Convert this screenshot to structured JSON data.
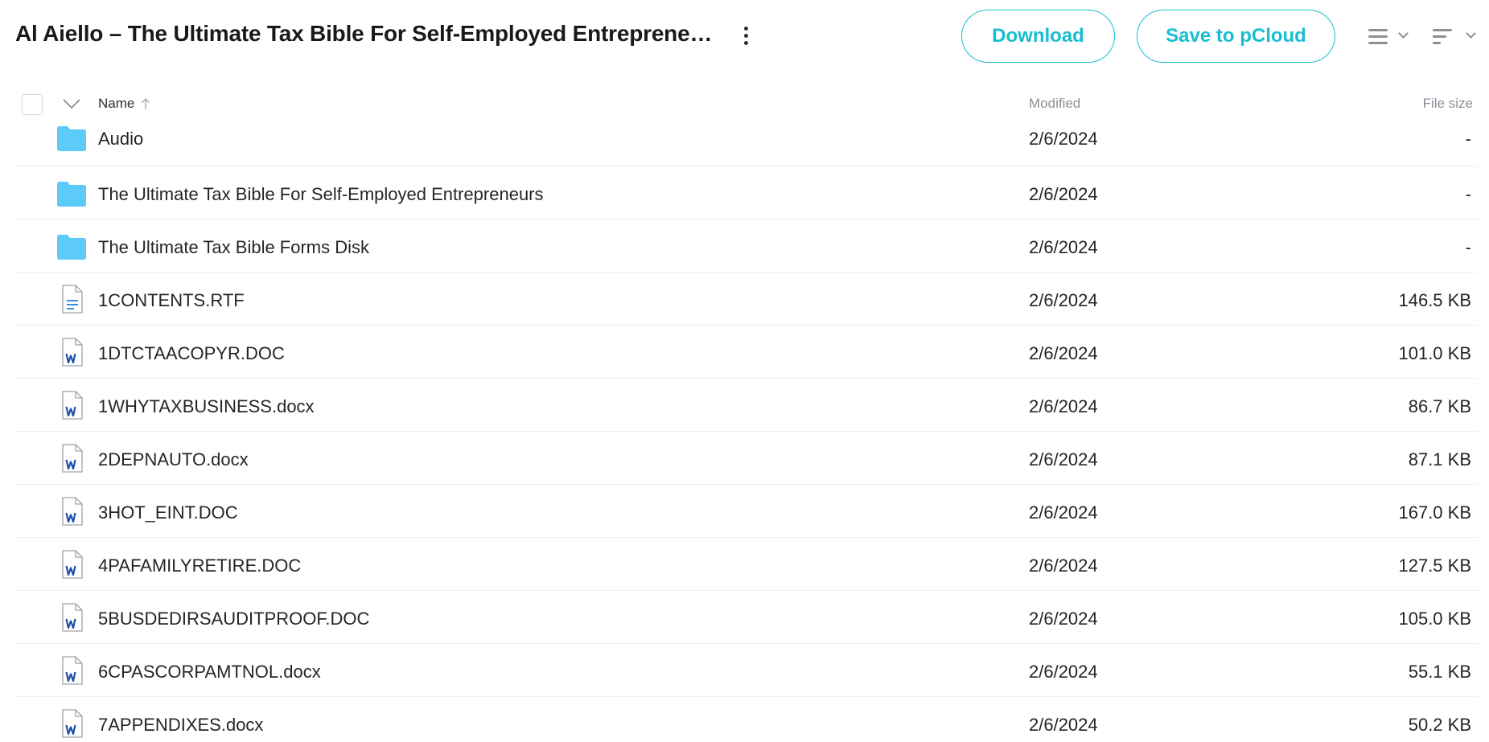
{
  "header": {
    "title": "Al Aiello – The Ultimate Tax Bible For Self-Employed Entrepreneurs",
    "download_label": "Download",
    "save_label": "Save to pCloud"
  },
  "columns": {
    "name": "Name",
    "modified": "Modified",
    "size": "File size"
  },
  "colors": {
    "accent": "#17bed0",
    "folder": "#5ccbf9",
    "word": "#1f4fa6",
    "text_doc": "#3b8ee8"
  },
  "files": [
    {
      "name": "Audio",
      "modified": "2/6/2024",
      "size": "-",
      "type": "folder"
    },
    {
      "name": "The Ultimate Tax Bible For Self-Employed Entrepreneurs",
      "modified": "2/6/2024",
      "size": "-",
      "type": "folder"
    },
    {
      "name": "The Ultimate Tax Bible Forms Disk",
      "modified": "2/6/2024",
      "size": "-",
      "type": "folder"
    },
    {
      "name": "1CONTENTS.RTF",
      "modified": "2/6/2024",
      "size": "146.5 KB",
      "type": "text"
    },
    {
      "name": "1DTCTAACOPYR.DOC",
      "modified": "2/6/2024",
      "size": "101.0 KB",
      "type": "word"
    },
    {
      "name": "1WHYTAXBUSINESS.docx",
      "modified": "2/6/2024",
      "size": "86.7 KB",
      "type": "word"
    },
    {
      "name": "2DEPNAUTO.docx",
      "modified": "2/6/2024",
      "size": "87.1 KB",
      "type": "word"
    },
    {
      "name": "3HOT_EINT.DOC",
      "modified": "2/6/2024",
      "size": "167.0 KB",
      "type": "word"
    },
    {
      "name": "4PAFAMILYRETIRE.DOC",
      "modified": "2/6/2024",
      "size": "127.5 KB",
      "type": "word"
    },
    {
      "name": "5BUSDEDIRSAUDITPROOF.DOC",
      "modified": "2/6/2024",
      "size": "105.0 KB",
      "type": "word"
    },
    {
      "name": "6CPASCORPAMTNOL.docx",
      "modified": "2/6/2024",
      "size": "55.1 KB",
      "type": "word"
    },
    {
      "name": "7APPENDIXES.docx",
      "modified": "2/6/2024",
      "size": "50.2 KB",
      "type": "word"
    }
  ]
}
